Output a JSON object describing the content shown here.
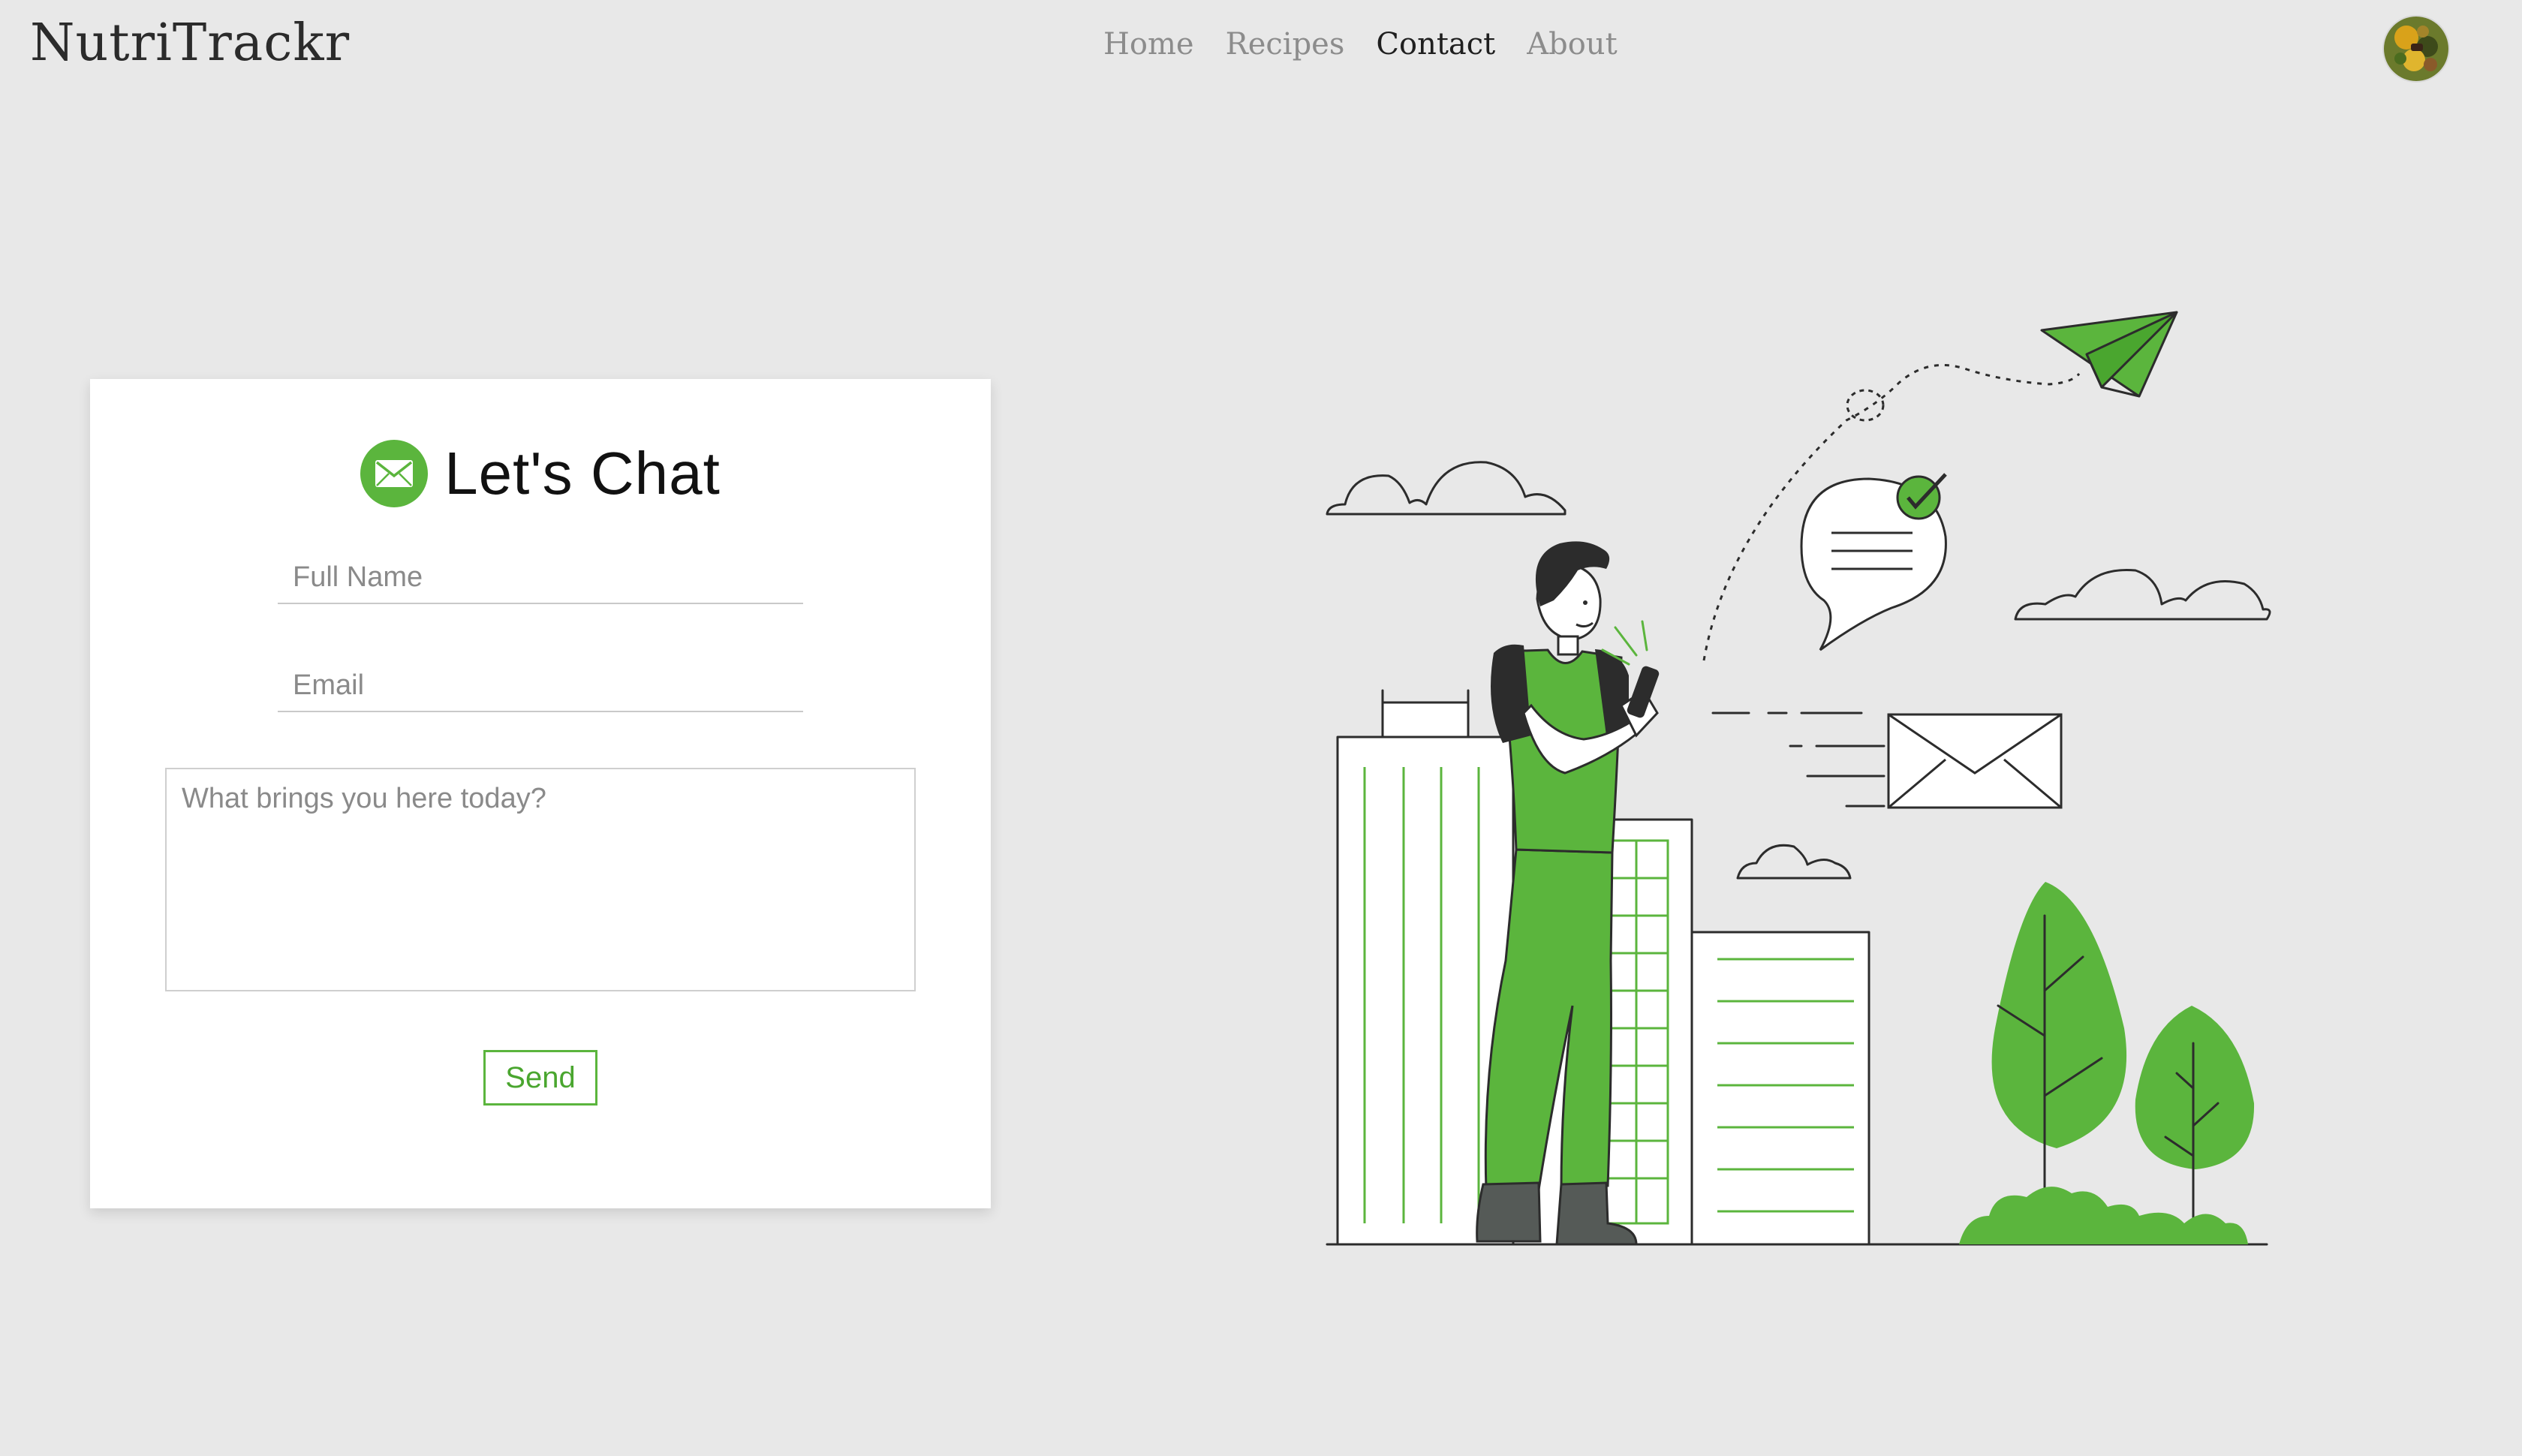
{
  "brand": {
    "name": "NutriTrackr"
  },
  "nav": {
    "items": [
      {
        "label": "Home",
        "active": false
      },
      {
        "label": "Recipes",
        "active": false
      },
      {
        "label": "Contact",
        "active": true
      },
      {
        "label": "About",
        "active": false
      }
    ]
  },
  "profile": {
    "avatar_icon": "user-avatar"
  },
  "contact_form": {
    "icon": "envelope-icon",
    "title": "Let's Chat",
    "name_placeholder": "Full Name",
    "name_value": "",
    "email_placeholder": "Email",
    "email_value": "",
    "message_placeholder": "What brings you here today?",
    "message_value": "",
    "send_label": "Send"
  },
  "illustration": {
    "subject": "contact-illustration",
    "colors": {
      "accent": "#5bb53d",
      "line": "#2c2c2c",
      "background": "#e8e8e8"
    }
  }
}
